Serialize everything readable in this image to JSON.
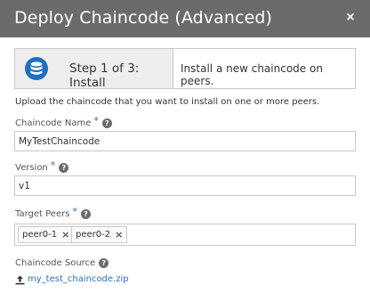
{
  "dialog": {
    "title": "Deploy Chaincode (Advanced)",
    "close_label": "×"
  },
  "stepper": {
    "icon": "database-icon",
    "step_label": "Step 1 of 3: Install",
    "description": "Install a new chaincode on peers.",
    "accent_color": "#1e6fbf"
  },
  "intro_text": "Upload the chaincode that you want to install on one or more peers.",
  "fields": {
    "chaincode_name": {
      "label": "Chaincode Name",
      "required": "*",
      "value": "MyTestChaincode"
    },
    "version": {
      "label": "Version",
      "required": "*",
      "value": "v1"
    },
    "target_peers": {
      "label": "Target Peers",
      "required": "*",
      "chips": [
        {
          "label": "peer0-1",
          "remove": "×"
        },
        {
          "label": "peer0-2",
          "remove": "×"
        }
      ]
    },
    "chaincode_source": {
      "label": "Chaincode Source",
      "file_name": "my_test_chaincode.zip"
    }
  },
  "help_glyph": "?"
}
